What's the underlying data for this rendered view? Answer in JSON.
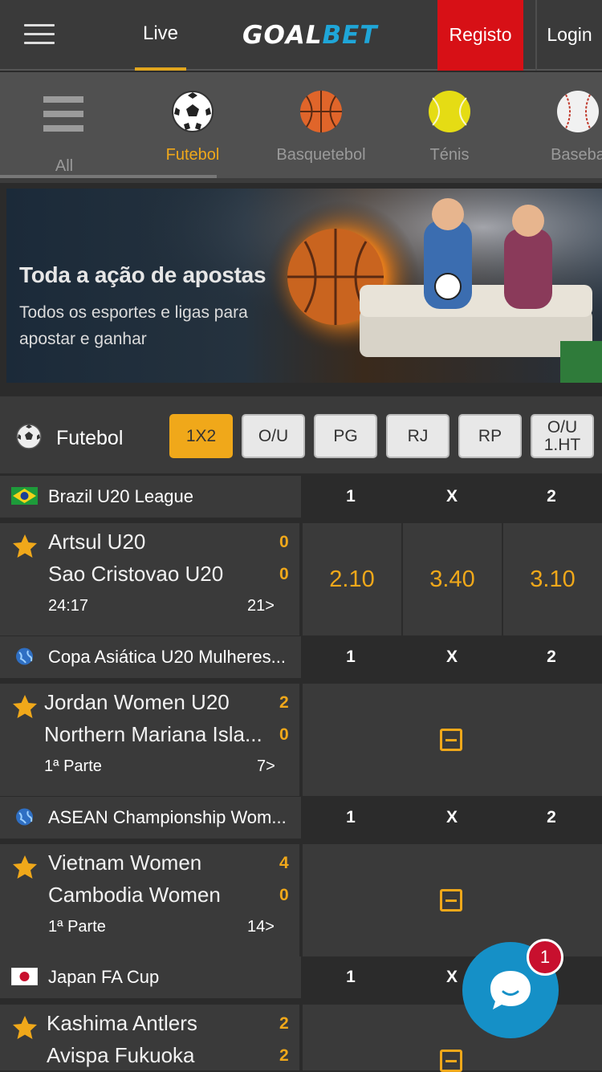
{
  "header": {
    "live_label": "Live",
    "logo_goal": "GOAL",
    "logo_bet": "BET",
    "register_label": "Registo",
    "login_label": "Login"
  },
  "sports": [
    {
      "label": "All",
      "icon": "all-list-icon"
    },
    {
      "label": "Futebol",
      "icon": "soccer-ball-icon",
      "active": true
    },
    {
      "label": "Basquetebol",
      "icon": "basketball-icon"
    },
    {
      "label": "Ténis",
      "icon": "tennis-ball-icon"
    },
    {
      "label": "Baseba",
      "icon": "baseball-icon"
    }
  ],
  "banner": {
    "title": "Toda a ação de apostas",
    "subtitle": "Todos os esportes e ligas para apostar e ganhar"
  },
  "filter": {
    "sport": "Futebol",
    "markets": [
      "1X2",
      "O/U",
      "PG",
      "RJ",
      "RP",
      "O/U 1.HT"
    ],
    "active_market": "1X2"
  },
  "leagues": [
    {
      "name": "Brazil U20 League",
      "flag": "brazil-flag-icon",
      "cols": [
        "1",
        "X",
        "2"
      ],
      "match": {
        "home": "Artsul U20",
        "away": "Sao Cristovao U20",
        "home_score": "0",
        "away_score": "0",
        "time": "24:17",
        "more": "21>",
        "odds": [
          "2.10",
          "3.40",
          "3.10"
        ]
      }
    },
    {
      "name": "Copa Asiática U20 Mulheres...",
      "flag": "globe-icon",
      "cols": [
        "1",
        "X",
        "2"
      ],
      "match": {
        "home": "Jordan Women U20",
        "away": "Northern Mariana Isla...",
        "home_score": "2",
        "away_score": "0",
        "time": "1ª Parte",
        "more": "7>",
        "locked": true
      }
    },
    {
      "name": "ASEAN Championship Wom...",
      "flag": "globe-icon",
      "cols": [
        "1",
        "X",
        "2"
      ],
      "match": {
        "home": "Vietnam Women",
        "away": "Cambodia Women",
        "home_score": "4",
        "away_score": "0",
        "time": "1ª Parte",
        "more": "14>",
        "locked": true
      }
    },
    {
      "name": "Japan FA Cup",
      "flag": "japan-flag-icon",
      "cols": [
        "1",
        "X",
        "2"
      ],
      "match": {
        "home": "Kashima Antlers",
        "away": "Avispa Fukuoka",
        "home_score": "2",
        "away_score": "2",
        "locked": true
      }
    }
  ],
  "chat": {
    "badge_count": "1"
  },
  "colors": {
    "accent": "#f0a81a",
    "register": "#d71016",
    "chat": "#1590c7",
    "logo_bet": "#1fa6d8"
  }
}
